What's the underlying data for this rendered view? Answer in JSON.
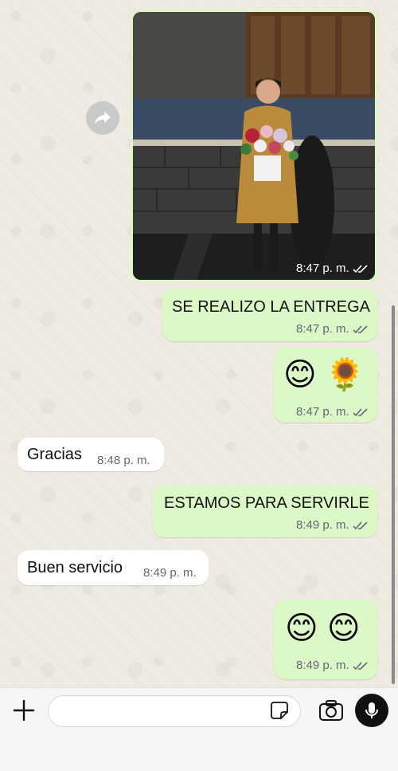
{
  "messages": [
    {
      "type": "image",
      "direction": "outgoing",
      "time": "8:47 p. m.",
      "status": "read"
    },
    {
      "type": "text",
      "direction": "outgoing",
      "text": "SE REALIZO LA ENTREGA",
      "time": "8:47 p. m.",
      "status": "read"
    },
    {
      "type": "emoji",
      "direction": "outgoing",
      "text": "😊 🌻",
      "time": "8:47 p. m.",
      "status": "read"
    },
    {
      "type": "text",
      "direction": "incoming",
      "text": "Gracias",
      "time": "8:48 p. m."
    },
    {
      "type": "text",
      "direction": "outgoing",
      "text": "ESTAMOS PARA SERVIRLE",
      "time": "8:49 p. m.",
      "status": "read"
    },
    {
      "type": "text",
      "direction": "incoming",
      "text": "Buen servicio",
      "time": "8:49 p. m."
    },
    {
      "type": "emoji",
      "direction": "outgoing",
      "text": "😊 😊",
      "time": "8:49 p. m.",
      "status": "read"
    }
  ],
  "composer": {
    "placeholder": "",
    "icons": [
      "plus-icon",
      "sticker-icon",
      "camera-icon",
      "microphone-icon"
    ]
  },
  "colors": {
    "outgoing_bubble": "#dcf8c6",
    "incoming_bubble": "#ffffff",
    "chat_background": "#efeae2",
    "read_ticks": "#667"
  }
}
